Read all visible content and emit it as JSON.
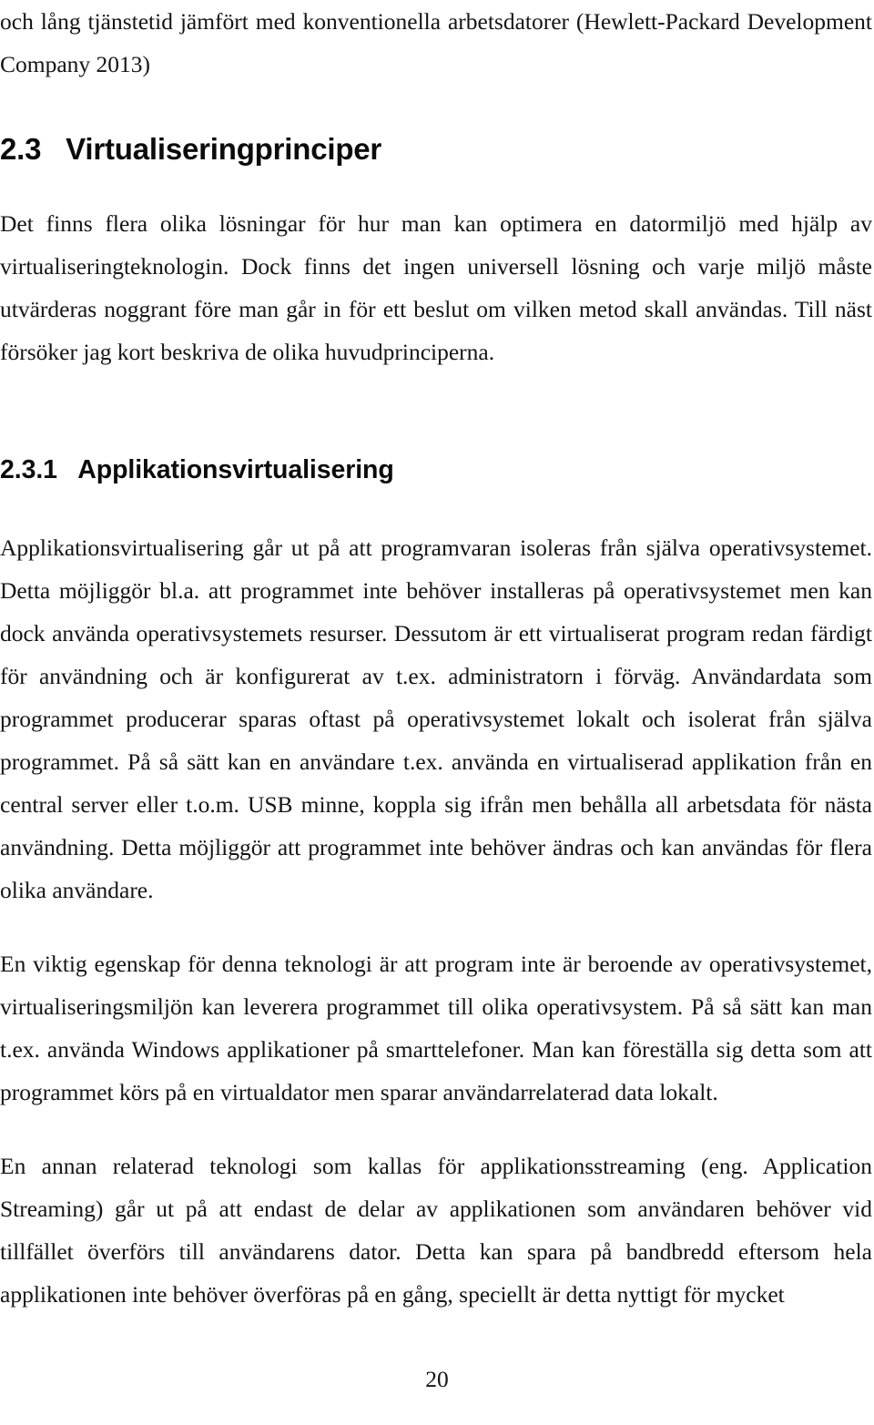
{
  "document": {
    "language": "sv",
    "page_number": "20",
    "text_color": "#141414",
    "background_color": "#ffffff"
  },
  "content": {
    "continued_paragraph": "och lång tjänstetid jämfört med konventionella arbetsdatorer (Hewlett-Packard Development Company 2013)",
    "section_heading": {
      "number": "2.3",
      "title": "Virtualiseringprinciper",
      "full": "2.3   Virtualiseringprinciper"
    },
    "section_intro_paragraph": "Det finns flera olika lösningar för hur man kan optimera en datormiljö med hjälp av virtualiseringteknologin. Dock finns det ingen universell lösning och varje miljö måste utvärderas noggrant före man går in för ett beslut om vilken metod skall användas. Till näst försöker jag kort beskriva de olika huvudprinciperna.",
    "subsection_heading": {
      "number": "2.3.1",
      "title": "Applikationsvirtualisering",
      "full": "2.3.1   Applikationsvirtualisering"
    },
    "paragraphs": [
      "Applikationsvirtualisering går ut på att programvaran isoleras från själva operativsystemet. Detta möjliggör bl.a. att programmet inte behöver installeras på operativsystemet men kan dock använda operativsystemets resurser. Dessutom är ett virtualiserat program redan färdigt för användning och är konfigurerat av t.ex. administratorn i förväg. Användardata som programmet producerar sparas oftast på operativsystemet lokalt och isolerat från själva programmet. På så sätt kan en användare t.ex. använda en virtualiserad applikation från en central server eller t.o.m. USB minne, koppla sig ifrån men behålla all arbetsdata för nästa användning. Detta möjliggör att programmet inte behöver ändras och kan användas för flera olika användare.",
      "En viktig egenskap för denna teknologi är att program inte är beroende av operativsystemet, virtualiseringsmiljön kan leverera programmet till olika operativsystem. På så sätt kan man t.ex. använda Windows applikationer på smarttelefoner. Man kan föreställa sig detta som att programmet körs på en virtualdator men sparar användarrelaterad data lokalt.",
      "En annan relaterad teknologi som kallas för applikationsstreaming (eng. Application Streaming) går ut på att endast de delar av applikationen som användaren behöver vid tillfället överförs till användarens dator. Detta kan spara på bandbredd eftersom hela applikationen inte behöver överföras på en gång, speciellt är detta nyttigt för mycket"
    ]
  }
}
